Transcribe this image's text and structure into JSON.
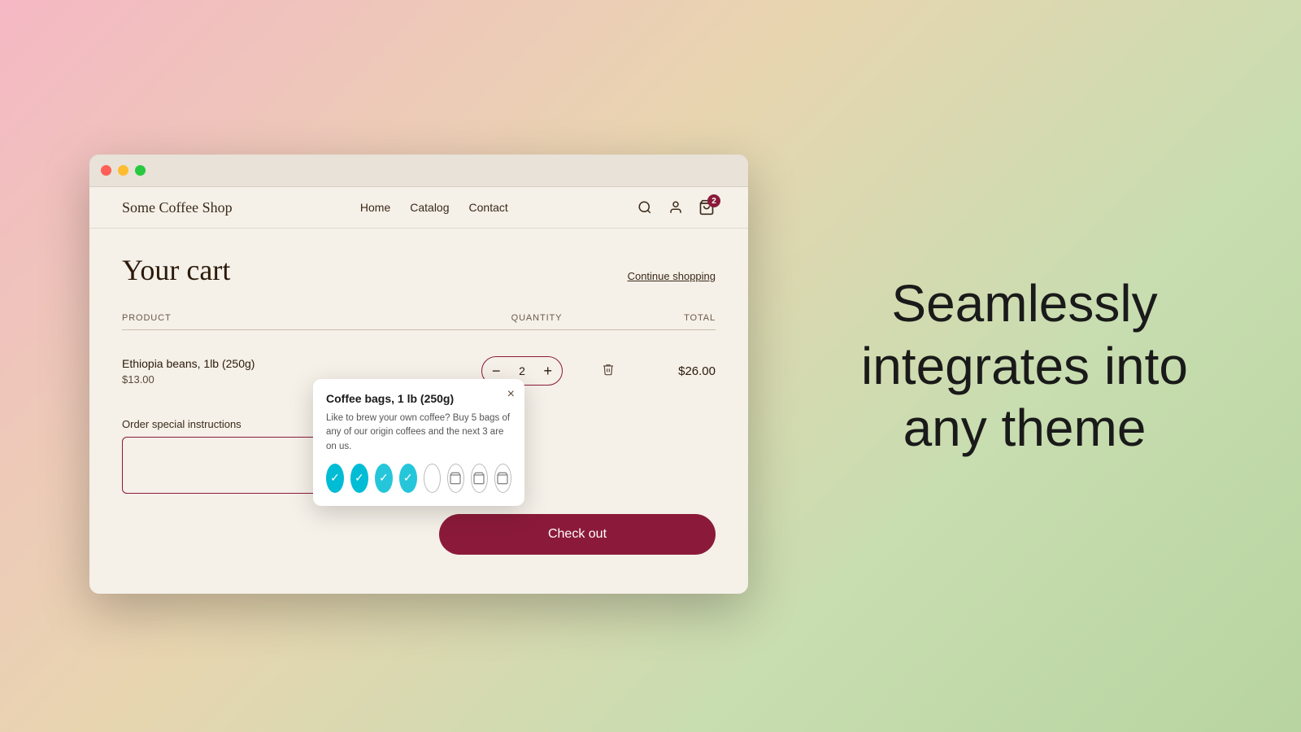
{
  "background": {
    "gradient": "linear-gradient(135deg, #f5b8c4, #e8d5b0, #c8ddb0, #b8d4a0)"
  },
  "browser": {
    "traffic_lights": [
      "red",
      "yellow",
      "green"
    ]
  },
  "store": {
    "logo": "Some Coffee Shop",
    "nav": [
      {
        "label": "Home"
      },
      {
        "label": "Catalog"
      },
      {
        "label": "Contact"
      }
    ],
    "cart_count": "2"
  },
  "cart": {
    "title": "Your cart",
    "continue_shopping": "Continue shopping",
    "columns": {
      "product": "PRODUCT",
      "quantity": "QUANTITY",
      "total": "TOTAL"
    },
    "items": [
      {
        "name": "Ethiopia beans, 1lb (250g)",
        "price": "$13.00",
        "quantity": 2,
        "total": "$26.00"
      }
    ],
    "instructions_label": "Order special instructions",
    "instructions_placeholder": ""
  },
  "upsell": {
    "title": "Coffee bags, 1 lb (250g)",
    "description": "Like to brew your own coffee? Buy 5 bags of any of our origin coffees and the next 3 are on us.",
    "close_label": "×",
    "icons": [
      {
        "type": "checked-cyan",
        "symbol": "✓"
      },
      {
        "type": "checked-cyan",
        "symbol": "✓"
      },
      {
        "type": "checked-teal",
        "symbol": "✓"
      },
      {
        "type": "checked-teal",
        "symbol": "✓"
      },
      {
        "type": "outlined",
        "symbol": ""
      },
      {
        "type": "bag-icon",
        "symbol": "🛍"
      },
      {
        "type": "bag-icon",
        "symbol": "🛍"
      },
      {
        "type": "bag-icon",
        "symbol": "🛍"
      }
    ]
  },
  "checkout": {
    "button_label": "Check out"
  },
  "promo": {
    "line1": "Seamlessly",
    "line2": "integrates into",
    "line3": "any theme"
  }
}
